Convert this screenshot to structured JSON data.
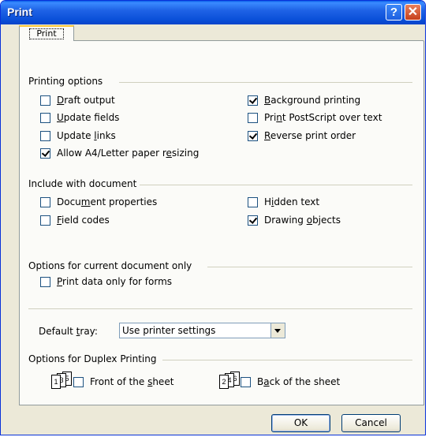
{
  "window": {
    "title": "Print"
  },
  "titlebar": {
    "help_glyph": "?",
    "close_glyph": "✕"
  },
  "tab": {
    "label": "Print"
  },
  "printing_options": {
    "title": "Printing options",
    "draft_output": {
      "label_pre": "",
      "label_u": "D",
      "label_post": "raft output",
      "checked": false
    },
    "update_fields": {
      "label_pre": "",
      "label_u": "U",
      "label_post": "pdate fields",
      "checked": false
    },
    "update_links": {
      "label_pre": "Update ",
      "label_u": "l",
      "label_post": "inks",
      "checked": false
    },
    "allow_resize": {
      "label_pre": "Allow A4/Letter paper r",
      "label_u": "e",
      "label_post": "sizing",
      "checked": true
    },
    "background_printing": {
      "label_pre": "",
      "label_u": "B",
      "label_post": "ackground printing",
      "checked": true
    },
    "print_postscript": {
      "label_pre": "Pri",
      "label_u": "n",
      "label_post": "t PostScript over text",
      "checked": false
    },
    "reverse_order": {
      "label_pre": "",
      "label_u": "R",
      "label_post": "everse print order",
      "checked": true
    }
  },
  "include_with_document": {
    "title": "Include with document",
    "document_properties": {
      "label_pre": "Docu",
      "label_u": "m",
      "label_post": "ent properties",
      "checked": false
    },
    "field_codes": {
      "label_pre": "",
      "label_u": "F",
      "label_post": "ield codes",
      "checked": false
    },
    "hidden_text": {
      "label_pre": "H",
      "label_u": "i",
      "label_post": "dden text",
      "checked": false
    },
    "drawing_objects": {
      "label_pre": "Drawing ",
      "label_u": "o",
      "label_post": "bjects",
      "checked": true
    }
  },
  "current_doc_options": {
    "title": "Options for current document only",
    "print_data_only": {
      "label_pre": "",
      "label_u": "P",
      "label_post": "rint data only for forms",
      "checked": false
    }
  },
  "default_tray": {
    "label_pre": "Default ",
    "label_u": "t",
    "label_post": "ray:",
    "value": "Use printer settings"
  },
  "duplex": {
    "title": "Options for Duplex Printing",
    "front_icon_pages": [
      "1",
      "3",
      "5"
    ],
    "back_icon_pages": [
      "2",
      "4",
      "6"
    ],
    "front": {
      "label_pre": "Front of the ",
      "label_u": "s",
      "label_post": "heet",
      "checked": false
    },
    "back": {
      "label_pre": "B",
      "label_u": "a",
      "label_post": "ck of the sheet",
      "checked": false
    }
  },
  "buttons": {
    "ok": "OK",
    "cancel": "Cancel"
  }
}
